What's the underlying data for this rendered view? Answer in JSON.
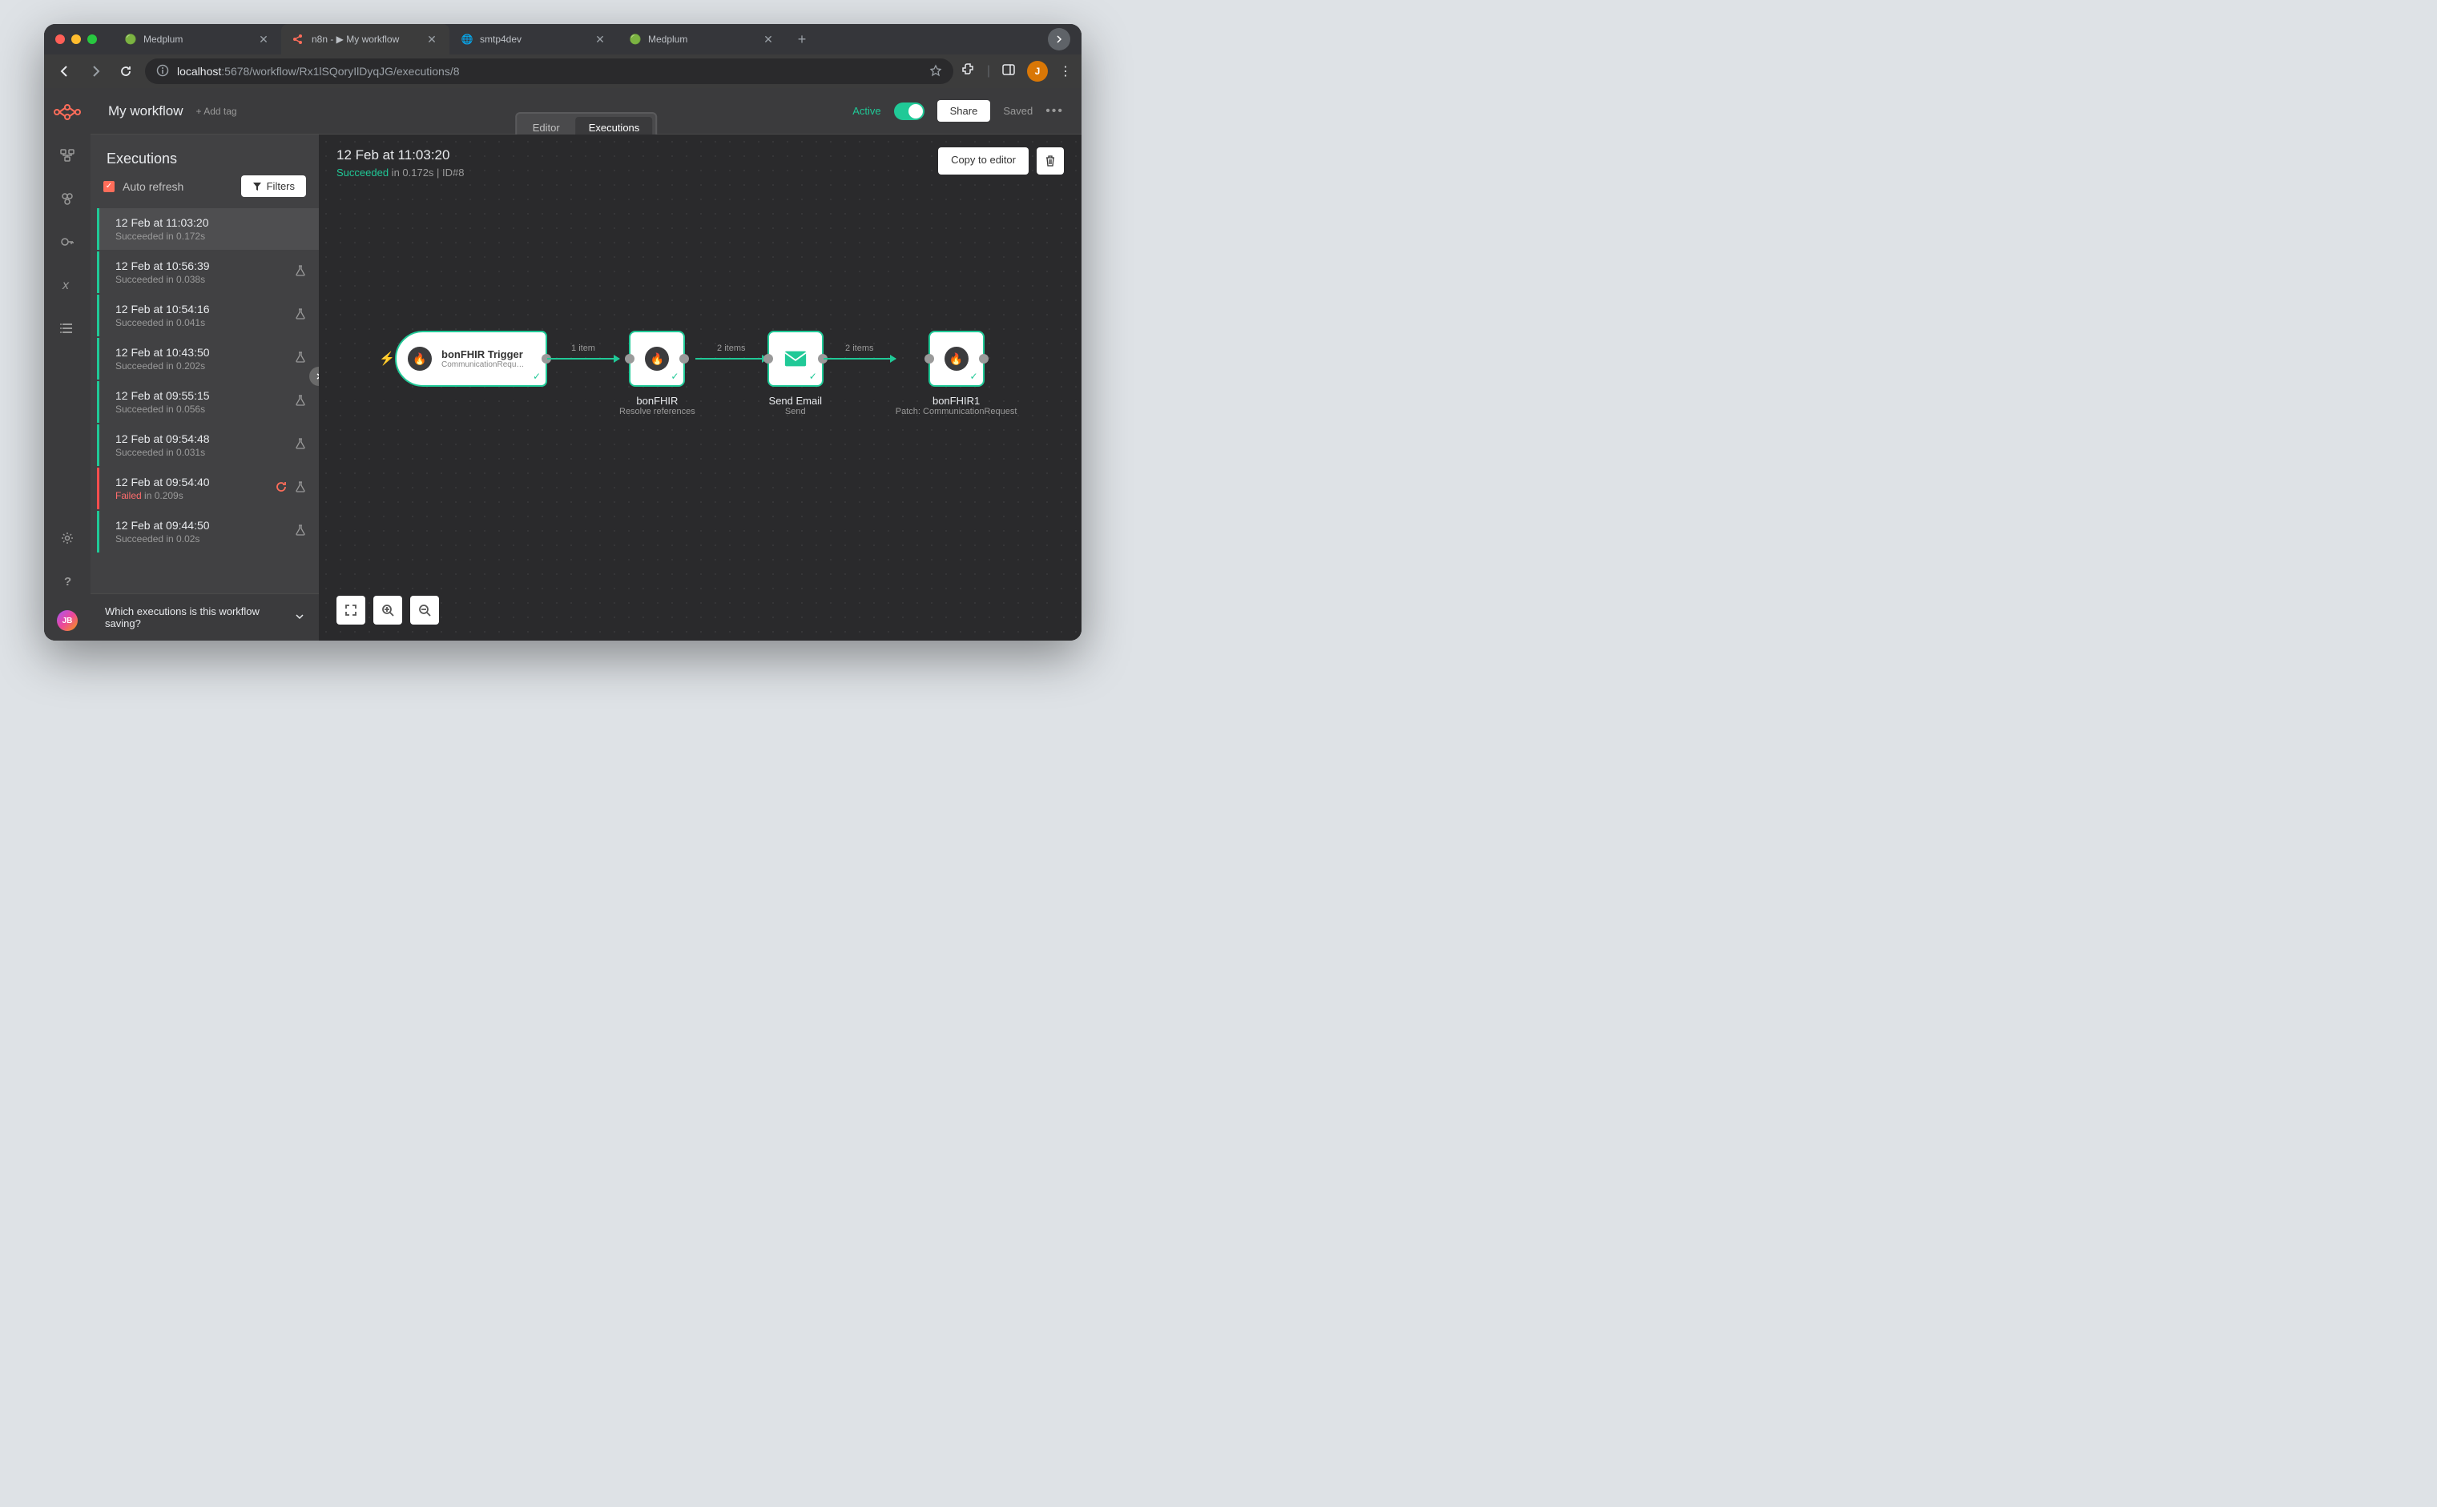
{
  "browser": {
    "tabs": [
      {
        "title": "Medplum",
        "active": false,
        "icon_color": "#22c55e"
      },
      {
        "title": "n8n - ▶ My workflow",
        "active": true,
        "icon_color": "#ff6d5a"
      },
      {
        "title": "smtp4dev",
        "active": false,
        "icon_color": "#9aa0a6"
      },
      {
        "title": "Medplum",
        "active": false,
        "icon_color": "#22c55e"
      }
    ],
    "url_host": "localhost",
    "url_path": ":5678/workflow/Rx1lSQoryIlDyqJG/executions/8",
    "avatar_letter": "J"
  },
  "topbar": {
    "workflow_name": "My workflow",
    "add_tag": "+ Add tag",
    "active_label": "Active",
    "share_label": "Share",
    "saved_label": "Saved"
  },
  "view_tabs": {
    "editor": "Editor",
    "executions": "Executions"
  },
  "exec_panel": {
    "title": "Executions",
    "auto_refresh": "Auto refresh",
    "filters": "Filters",
    "footer": "Which executions is this workflow saving?",
    "items": [
      {
        "time": "12 Feb at 11:03:20",
        "status": "Succeeded in 0.172s",
        "selected": true,
        "flask": false
      },
      {
        "time": "12 Feb at 10:56:39",
        "status": "Succeeded in 0.038s",
        "flask": true
      },
      {
        "time": "12 Feb at 10:54:16",
        "status": "Succeeded in 0.041s",
        "flask": true
      },
      {
        "time": "12 Feb at 10:43:50",
        "status": "Succeeded in 0.202s",
        "flask": true
      },
      {
        "time": "12 Feb at 09:55:15",
        "status": "Succeeded in 0.056s",
        "flask": true
      },
      {
        "time": "12 Feb at 09:54:48",
        "status": "Succeeded in 0.031s",
        "flask": true
      },
      {
        "time": "12 Feb at 09:54:40",
        "status_prefix": "Failed",
        "status_suffix": " in 0.209s",
        "failed": true,
        "retry": true,
        "flask": true
      },
      {
        "time": "12 Feb at 09:44:50",
        "status": "Succeeded in 0.02s",
        "flask": true
      }
    ]
  },
  "canvas": {
    "date": "12 Feb at 11:03:20",
    "status_label": "Succeeded",
    "status_meta": " in 0.172s | ID#8",
    "copy_label": "Copy to editor"
  },
  "nodes": {
    "trigger": {
      "title": "bonFHIR Trigger",
      "sub": "CommunicationRequ…"
    },
    "n1": {
      "name": "bonFHIR",
      "desc": "Resolve references"
    },
    "n2": {
      "name": "Send Email",
      "desc": "Send"
    },
    "n3": {
      "name": "bonFHIR1",
      "desc": "Patch: CommunicationRequest"
    },
    "conn1": "1 item",
    "conn2": "2 items",
    "conn3": "2 items"
  },
  "sidenav_avatar": "JB"
}
